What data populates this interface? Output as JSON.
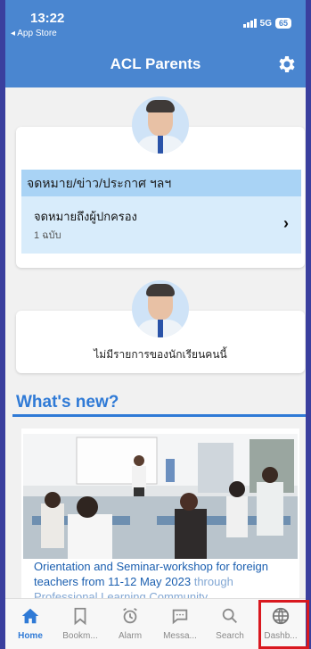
{
  "status": {
    "time": "13:22",
    "back_app": "◂ App Store",
    "network": "5G",
    "battery": "65"
  },
  "nav": {
    "title": "ACL Parents"
  },
  "student1": {
    "section_header": "จดหมาย/ข่าว/ประกาศ ฯลฯ",
    "item_title": "จดหมายถึงผู้ปกครอง",
    "item_sub": "1 ฉบับ",
    "chevron": "›"
  },
  "student2": {
    "empty_text": "ไม่มีรายการของนักเรียนคนนี้"
  },
  "whats_new": {
    "heading": "What's new?",
    "caption": "Orientation and Seminar-workshop for foreign teachers from 11-12 May 2023",
    "caption_cut": "through Professional Learning Community"
  },
  "tabs": [
    {
      "label": "Home",
      "icon": "home-icon"
    },
    {
      "label": "Bookm...",
      "icon": "bookmark-icon"
    },
    {
      "label": "Alarm",
      "icon": "alarm-icon"
    },
    {
      "label": "Messa...",
      "icon": "message-icon"
    },
    {
      "label": "Search",
      "icon": "search-icon"
    },
    {
      "label": "Dashb...",
      "icon": "globe-icon"
    }
  ],
  "colors": {
    "header_blue": "#4a86d0",
    "accent_blue": "#2f7ad6",
    "section_blue": "#a9d3f5",
    "highlight_red": "#d9181f"
  }
}
